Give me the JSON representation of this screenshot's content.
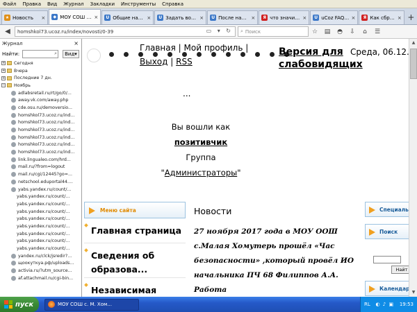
{
  "menubar": [
    "Файл",
    "Правка",
    "Вид",
    "Журнал",
    "Закладки",
    "Инструменты",
    "Справка"
  ],
  "tabs": [
    {
      "label": "Новость",
      "color": "#e0901a",
      "glyph": "★"
    },
    {
      "label": "МОУ СОШ с...",
      "color": "#3c78c8",
      "glyph": "◆"
    },
    {
      "label": "Общие настр...",
      "color": "#3c78c8",
      "glyph": "U"
    },
    {
      "label": "Задать вопро...",
      "color": "#3c78c8",
      "glyph": "U"
    },
    {
      "label": "После накат...",
      "color": "#3c78c8",
      "glyph": "U"
    },
    {
      "label": "что значит сб...",
      "color": "#d02020",
      "glyph": "Я"
    },
    {
      "label": "uCoz FAQ - О...",
      "color": "#3c78c8",
      "glyph": "U"
    },
    {
      "label": "Как сбросить...",
      "color": "#d02020",
      "glyph": "Я"
    }
  ],
  "nav": {
    "url": "homshkol73.ucoz.ru/index/novosti/0-39",
    "search_placeholder": "Поиск"
  },
  "sidebar": {
    "title": "Журнал",
    "search_label": "Найти:",
    "view_label": "Вид",
    "folders": [
      "Сегодня",
      "Вчера",
      "Последние 7 дн.",
      "Ноябрь"
    ],
    "links": [
      "adlabsretail.ru/rt/go/0/...",
      "away.vk.com/away.php",
      "cde.osu.ru/demoversio...",
      "homshkol73.ucoz.ru/ind...",
      "homshkol73.ucoz.ru/ind...",
      "homshkol73.ucoz.ru/ind...",
      "homshkol73.ucoz.ru/ind...",
      "homshkol73.ucoz.ru/ind...",
      "homshkol73.ucoz.ru/ind...",
      "link.lingualeo.com/hrd...",
      "mail.ru/?from=logout",
      "mail.ru/cgi/12445?go=...",
      "netschool.eduportal44....",
      "yabs.yandex.ru/count/..."
    ],
    "sub_links": [
      "yabs.yandex.ru/count/...",
      "yabs.yandex.ru/count/...",
      "yabs.yandex.ru/count/...",
      "yabs.yandex.ru/count/...",
      "yabs.yandex.ru/count/...",
      "yabs.yandex.ru/count/...",
      "yabs.yandex.ru/count/...",
      "yabs.yandex.ru/count/..."
    ],
    "tail_links": [
      "yandex.ru/clck/jsredir?...",
      "щоокуткуа.рф/uploads...",
      "activia.ru/?utm_source...",
      "af.attachmail.ru/cgi-bin..."
    ]
  },
  "page": {
    "topnav": "Главная | Мой профиль |",
    "exit_label": "Выход",
    "sep": "|",
    "rss_label": "RSS",
    "vision_line1": "Версия для",
    "vision_line2": "слабовидящих",
    "date": "Среда, 06.12.20",
    "dots": "...",
    "login_line1": "Вы вошли как",
    "login_user": "позитивчик",
    "login_group_label": "Группа",
    "login_group_open": "\"",
    "login_group_name": "Администраторы",
    "login_group_close": "\"",
    "menu_title": "Меню сайта",
    "menu_items": [
      "Главная страница",
      "Сведения об образова...",
      "Независимая"
    ],
    "news_title": "Новости",
    "news_text": "27 ноября 2017 года в МОУ ООШ с.Малая Хомутерь прошёл «Час безопасности» ,который провёл ИО начальника ПЧ 68 Филиппов А.А. Работа",
    "right_head1": "Специалы",
    "right_head2": "Поиск",
    "right_btn": "Найт",
    "right_head3": "Календар"
  },
  "taskbar": {
    "start": "пуск",
    "item": "МОУ СОШ с. М. Хом...",
    "lang": "RL",
    "time": "19:53"
  }
}
